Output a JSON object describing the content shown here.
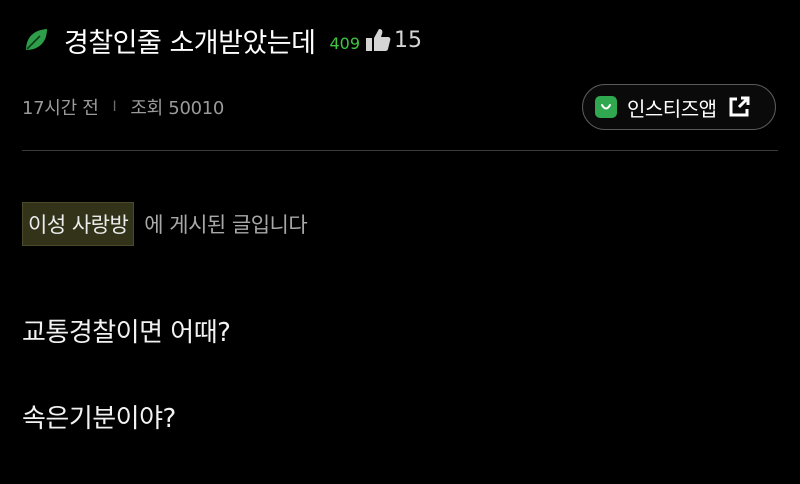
{
  "post": {
    "title": "경찰인줄 소개받았는데",
    "comment_count": "409",
    "like_count": "15",
    "time_ago": "17시간 전",
    "meta_separator": "I",
    "views": "조회 50010",
    "board_name": "이성 사랑방",
    "board_suffix": "에 게시된 글입니다",
    "body_lines": [
      "교통경찰이면 어때?",
      "속은기분이야?"
    ]
  },
  "app_button": {
    "label": "인스티즈앱",
    "logo_icon": "app-smile-logo-icon",
    "link_icon": "external-link-icon"
  },
  "icons": {
    "title_icon": "leaf-icon",
    "like_icon": "thumbs-up-icon"
  },
  "colors": {
    "background": "#000000",
    "accent_green": "#2fa84f",
    "comment_count_green": "#3ec63e",
    "board_tag_bg": "#33331a"
  }
}
